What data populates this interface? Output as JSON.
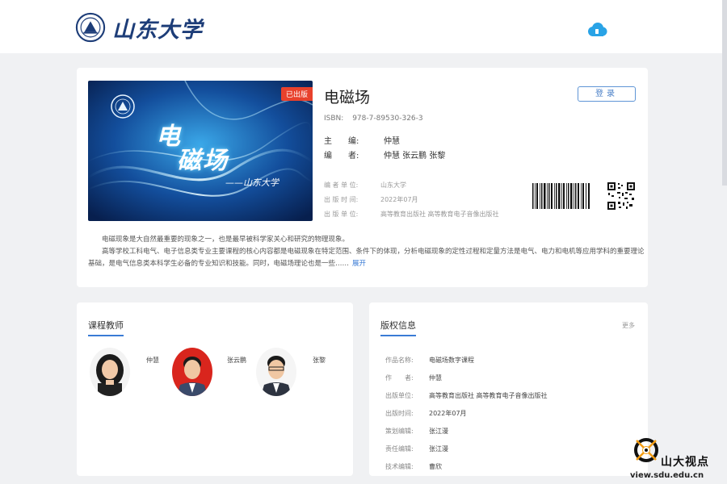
{
  "header": {
    "logo_text": "山东大学",
    "cloud_icon": "cloud-icon"
  },
  "book": {
    "title": "电磁场",
    "badge": "已出版",
    "isbn_label": "ISBN:",
    "isbn": "978-7-89530-326-3",
    "chief_editor_label": "主　　编:",
    "chief_editor": "仲慧",
    "authors_label": "编　　者:",
    "authors": "仲慧 张云鹏 张黎",
    "org_label": "编 者 单 位:",
    "org": "山东大学",
    "pub_date_label": "出 版 时 间:",
    "pub_date": "2022年07月",
    "publisher_label": "出 版 单 位:",
    "publisher": "高等教育出版社  高等教育电子音像出版社",
    "login_label": "登录",
    "cover_title_1": "电",
    "cover_title_2": "磁场",
    "cover_subtitle": "——山东大学",
    "description_1": "电磁现象是大自然最重要的现象之一，也是最早被科学家关心和研究的物理现象。",
    "description_2": "高等学校工科电气、电子信息类专业主要课程的核心内容都是电磁现象在特定范围、条件下的体现，分析电磁现象的定性过程和定量方法是电气、电力和电机等应用学科的重要理论基础，是电气信息类本科学生必备的专业知识和技能。同时，电磁场理论也是一些……",
    "expand_label": "展开"
  },
  "teachers": {
    "title": "课程教师",
    "items": [
      {
        "name": "仲慧"
      },
      {
        "name": "张云鹏"
      },
      {
        "name": "张黎"
      }
    ]
  },
  "copyright": {
    "title": "版权信息",
    "more_label": "更多",
    "rows": [
      {
        "label": "作品名称:",
        "value": "电磁场数字课程"
      },
      {
        "label": "作　　者:",
        "value": "仲慧"
      },
      {
        "label": "出版单位:",
        "value": "高等教育出版社  高等教育电子音像出版社"
      },
      {
        "label": "出版时间:",
        "value": "2022年07月"
      },
      {
        "label": "策划编辑:",
        "value": "张江漫"
      },
      {
        "label": "责任编辑:",
        "value": "张江漫"
      },
      {
        "label": "技术编辑:",
        "value": "曹欣"
      }
    ]
  },
  "watermark": {
    "text": "山大视点",
    "url": "view.sdu.edu.cn"
  },
  "colors": {
    "accent": "#3a7bd5",
    "badge": "#e8412c",
    "logo": "#1d3d78"
  }
}
